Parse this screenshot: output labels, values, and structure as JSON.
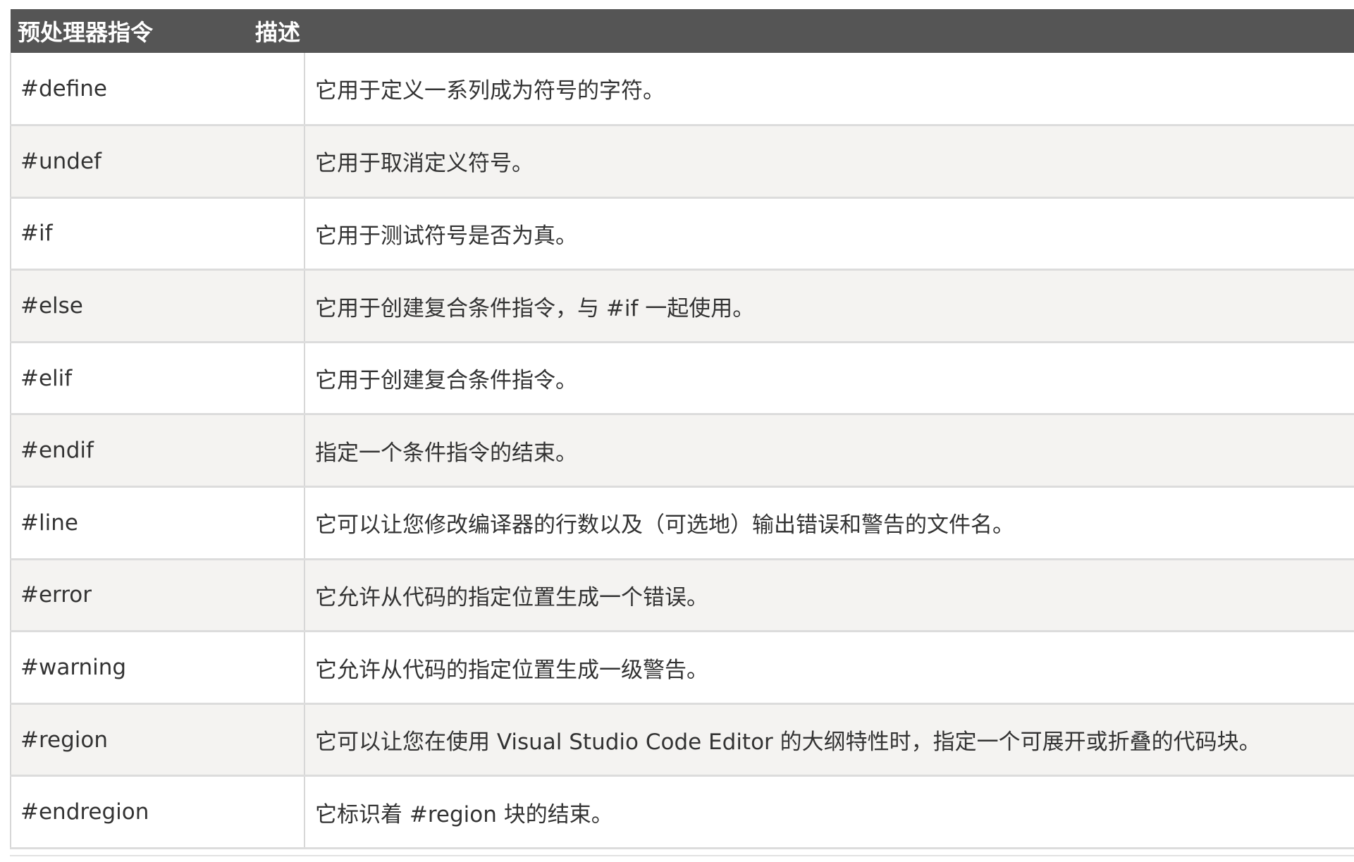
{
  "table": {
    "headers": [
      "预处理器指令",
      "描述"
    ],
    "rows": [
      {
        "directive": "#define",
        "description": "它用于定义一系列成为符号的字符。"
      },
      {
        "directive": "#undef",
        "description": "它用于取消定义符号。"
      },
      {
        "directive": "#if",
        "description": "它用于测试符号是否为真。"
      },
      {
        "directive": "#else",
        "description": "它用于创建复合条件指令，与 #if 一起使用。"
      },
      {
        "directive": "#elif",
        "description": "它用于创建复合条件指令。"
      },
      {
        "directive": "#endif",
        "description": "指定一个条件指令的结束。"
      },
      {
        "directive": "#line",
        "description": "它可以让您修改编译器的行数以及（可选地）输出错误和警告的文件名。"
      },
      {
        "directive": "#error",
        "description": "它允许从代码的指定位置生成一个错误。"
      },
      {
        "directive": "#warning",
        "description": "它允许从代码的指定位置生成一级警告。"
      },
      {
        "directive": "#region",
        "description": "它可以让您在使用 Visual Studio Code Editor 的大纲特性时，指定一个可展开或折叠的代码块。"
      },
      {
        "directive": "#endregion",
        "description": "它标识着 #region 块的结束。"
      }
    ]
  },
  "colors": {
    "header_bg": "#555555",
    "header_text": "#ffffff",
    "row_alt_bg": "#f4f3f1",
    "text": "#333333"
  }
}
